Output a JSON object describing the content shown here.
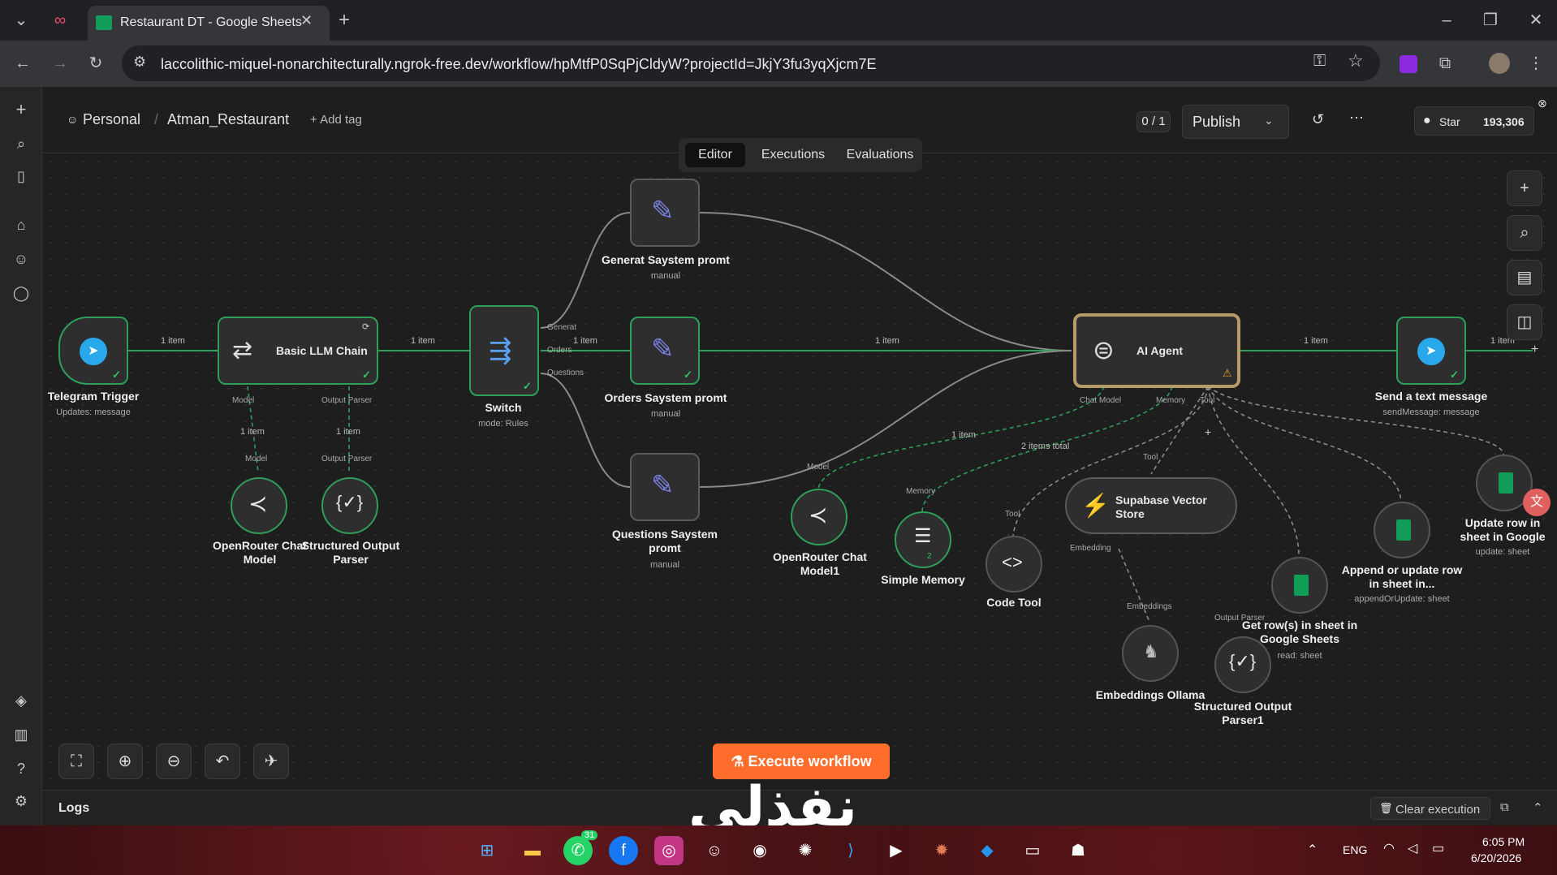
{
  "browser": {
    "tab_title": "Restaurant DT - Google Sheets",
    "url": "laccolithic-miquel-nonarchitecturally.ngrok-free.dev/workflow/hpMtfP0SqPjCldyW?projectId=JkjY3fu3yqXjcm7E"
  },
  "header": {
    "project": "Personal",
    "workflow_name": "Atman_Restaurant",
    "add_tag": "+ Add tag",
    "counter": "0 / 1",
    "publish": "Publish",
    "github_star": "Star",
    "star_count": "193,306"
  },
  "view_tabs": [
    "Editor",
    "Executions",
    "Evaluations"
  ],
  "nodes": {
    "telegram_trigger": {
      "label": "Telegram Trigger",
      "sub": "Updates: message"
    },
    "basic_llm": {
      "label": "Basic LLM Chain"
    },
    "switch": {
      "label": "Switch",
      "sub": "mode: Rules"
    },
    "generat": {
      "label": "Generat Saystem promt",
      "sub": "manual"
    },
    "orders": {
      "label": "Orders Saystem promt",
      "sub": "manual"
    },
    "questions": {
      "label": "Questions Saystem promt",
      "sub": "manual"
    },
    "ai_agent": {
      "label": "AI Agent"
    },
    "send_text": {
      "label": "Send a text message",
      "sub": "sendMessage: message"
    },
    "openrouter1": {
      "label": "OpenRouter Chat Model"
    },
    "structured1": {
      "label": "Structured Output Parser"
    },
    "openrouter2": {
      "label": "OpenRouter Chat Model1"
    },
    "simple_memory": {
      "label": "Simple Memory"
    },
    "code_tool": {
      "label": "Code Tool"
    },
    "supabase": {
      "label": "Supabase Vector Store"
    },
    "embeddings": {
      "label": "Embeddings Ollama"
    },
    "structured2": {
      "label": "Structured Output Parser1"
    },
    "get_rows": {
      "label": "Get row(s) in sheet in Google Sheets",
      "sub": "read: sheet"
    },
    "append_row": {
      "label": "Append or update row in sheet in...",
      "sub": "appendOrUpdate: sheet"
    },
    "update_row": {
      "label": "Update row in sheet in Google Sheets",
      "sub": "update: sheet"
    }
  },
  "ports": {
    "model": "Model",
    "output_parser": "Output Parser",
    "generat": "Generat",
    "orders": "Orders",
    "questions": "Questions",
    "chat_model": "Chat Model",
    "memory": "Memory",
    "tool": "Tool",
    "embedding": "Embedding",
    "embeddings": "Embeddings"
  },
  "edge_labels": {
    "one_item": "1 item",
    "two_items": "2 items total",
    "memory_count": "2"
  },
  "execute": "Execute workflow",
  "logs": "Logs",
  "clear_execution": "Clear execution",
  "taskbar": {
    "lang": "ENG",
    "time": "6:05 PM",
    "date": "6/20/2026",
    "badge": "31"
  },
  "watermark": "نفذلي"
}
